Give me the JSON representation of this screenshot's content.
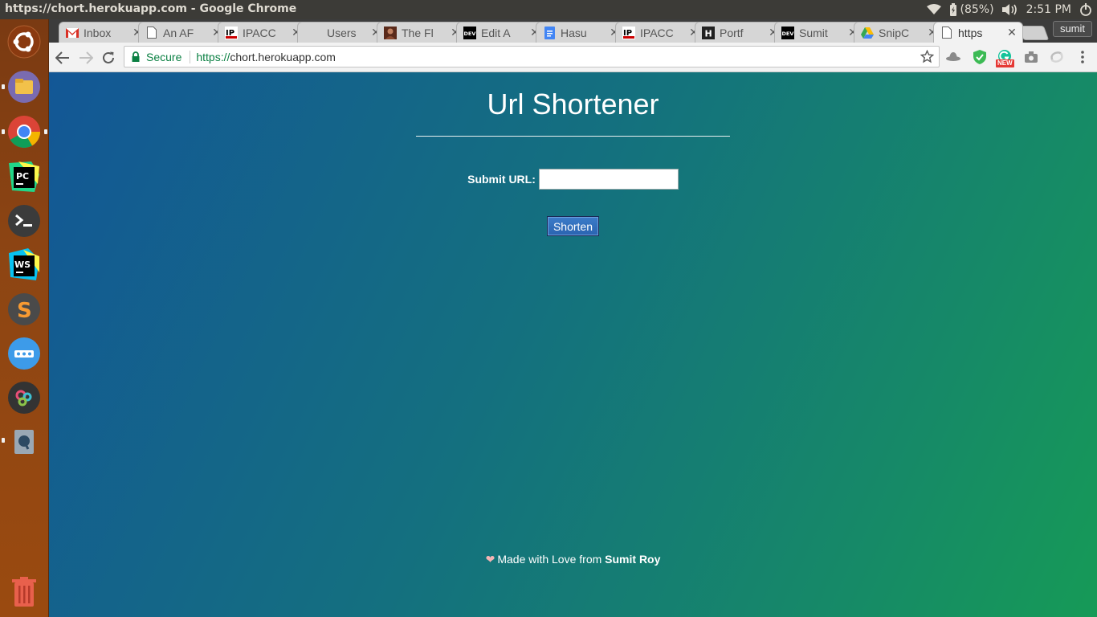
{
  "window": {
    "title": "https://chort.herokuapp.com - Google Chrome"
  },
  "system_tray": {
    "battery_percent": "(85%)",
    "clock": "2:51 PM"
  },
  "launcher": {
    "items": [
      "ubuntu-dash-icon",
      "files-icon",
      "chrome-icon",
      "pycharm-icon",
      "terminal-icon",
      "webstorm-icon",
      "sublime-text-icon",
      "more-apps-icon",
      "settings-gears-icon",
      "remmina-icon",
      "trash-icon"
    ]
  },
  "tabs": [
    {
      "title": "Inbox",
      "icon": "gmail-icon"
    },
    {
      "title": "An AF",
      "icon": "page-icon"
    },
    {
      "title": "IPACC",
      "icon": "ip-icon"
    },
    {
      "title": "Users",
      "icon": "none"
    },
    {
      "title": "The Fl",
      "icon": "portrait-icon"
    },
    {
      "title": "Edit A",
      "icon": "dev-icon"
    },
    {
      "title": "Hasu",
      "icon": "docs-icon"
    },
    {
      "title": "IPACC",
      "icon": "ip-icon"
    },
    {
      "title": "Portf",
      "icon": "h-icon"
    },
    {
      "title": "Sumit",
      "icon": "dev-icon"
    },
    {
      "title": "SnipC",
      "icon": "drive-icon"
    },
    {
      "title": "https",
      "icon": "page-icon"
    }
  ],
  "profile": {
    "name": "sumit"
  },
  "address_bar": {
    "secure_label": "Secure",
    "url_scheme": "https://",
    "url_host": "chort.herokuapp.com"
  },
  "extensions": {
    "grammarly_badge": "NEW"
  },
  "page": {
    "title": "Url Shortener",
    "form": {
      "label": "Submit URL:",
      "input_value": "",
      "button_label": "Shorten"
    },
    "footer": {
      "prefix": "Made with Love from",
      "author": "Sumit Roy"
    }
  },
  "colors": {
    "gradient_start": "#135796",
    "gradient_end": "#169a57",
    "secure_green": "#0b8043",
    "launcher": "#8d4513"
  }
}
